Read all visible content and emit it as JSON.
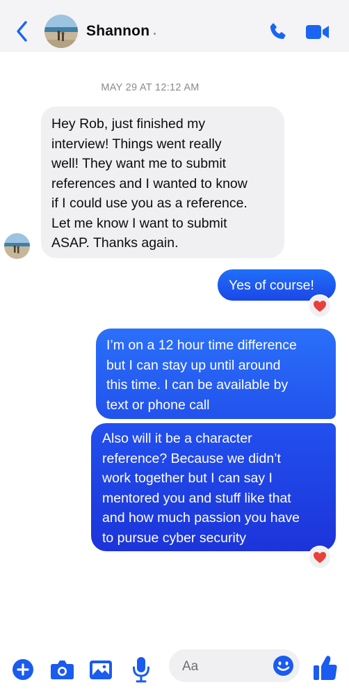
{
  "header": {
    "contact_name": "Shannon",
    "icons": [
      "back-chevron-icon",
      "avatar",
      "phone-icon",
      "video-camera-icon"
    ]
  },
  "conversation": {
    "timestamp": "MAY 29 AT 12:12 AM",
    "messages": [
      {
        "sender": "Shannon",
        "lines": [
          "Hey Rob, just finished my",
          "interview! Things went really",
          "well! They want me to submit",
          "references and I wanted to know",
          "if I could use you as a reference.",
          "Let me know I want to submit",
          "ASAP. Thanks again."
        ]
      },
      {
        "sender": "me",
        "lines": [
          "Yes of course!"
        ],
        "reaction": "❤️"
      },
      {
        "sender": "me",
        "lines": [
          "I’m on a 12 hour time difference",
          "but I can stay up until around",
          "this time. I can be available by",
          "text or phone call"
        ]
      },
      {
        "sender": "me",
        "lines": [
          "Also will it be a character",
          "reference? Because we didn’t",
          "work together but I can say I",
          "mentored you and stuff like that",
          "and how much passion you have",
          "to pursue cyber security"
        ],
        "reaction": "❤️"
      }
    ]
  },
  "composer": {
    "placeholder": "Aa",
    "icons": [
      "plus-icon",
      "camera-icon",
      "image-icon",
      "microphone-icon",
      "emoji-icon",
      "thumbs-up-icon"
    ]
  },
  "colors": {
    "accent": "#1c5cf2",
    "incoming_bubble": "#f0f0f2",
    "outgoing_bubble": "#1f56ec",
    "header_bg": "#f4f4f6"
  }
}
